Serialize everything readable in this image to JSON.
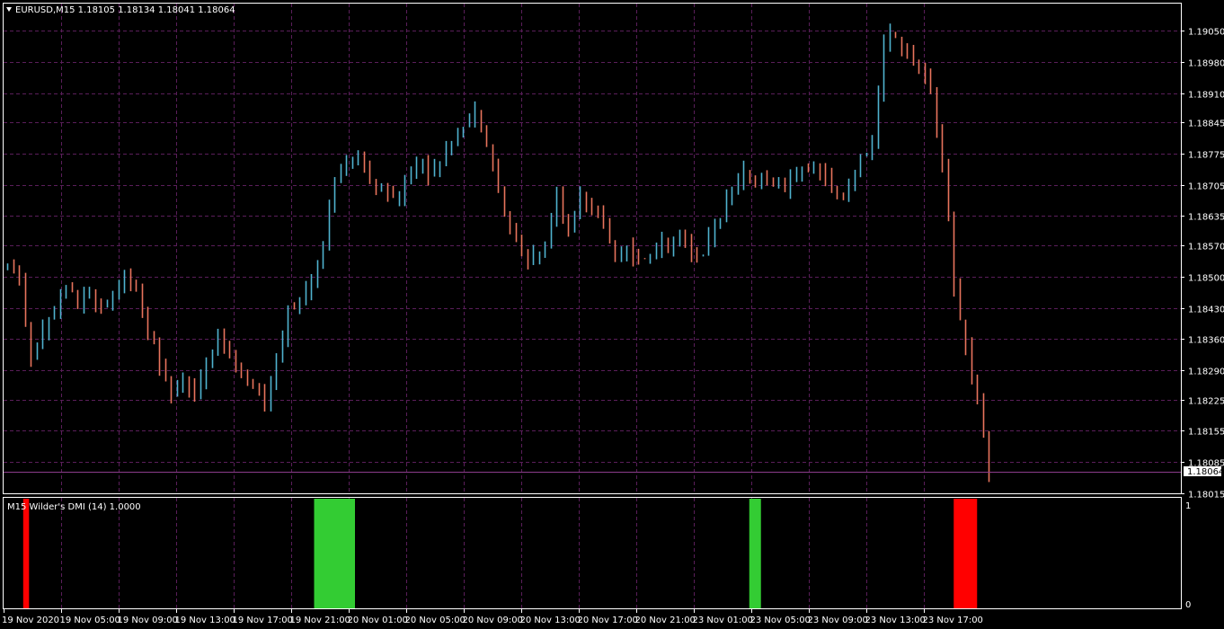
{
  "window": {
    "symbol_title": "EURUSD,M15  1.18105 1.18134 1.18041 1.18064",
    "menu_icon": "triangle-down-icon"
  },
  "indicator": {
    "title": "M15 Wilder's DMI (14) 1.0000",
    "scale_max": "1",
    "scale_min": "0"
  },
  "colors": {
    "background": "#000000",
    "grid": "#5a1e5a",
    "bull_candle": "#4fb3cf",
    "bear_candle": "#e8745c",
    "up_bar": "#33cc33",
    "down_bar": "#ff0000",
    "price_line": "#8c3c8c"
  },
  "chart_data": [
    {
      "type": "candlestick",
      "symbol": "EURUSD",
      "timeframe": "M15",
      "ylim": [
        1.18015,
        1.19075
      ],
      "grid": true,
      "y_ticks": [
        "1.19050",
        "1.18980",
        "1.18910",
        "1.18845",
        "1.18775",
        "1.18705",
        "1.18635",
        "1.18570",
        "1.18500",
        "1.18430",
        "1.18360",
        "1.18290",
        "1.18225",
        "1.18155",
        "1.18085",
        "1.18015"
      ],
      "x_ticks": [
        "19 Nov 2020",
        "19 Nov 05:00",
        "19 Nov 09:00",
        "19 Nov 13:00",
        "19 Nov 17:00",
        "19 Nov 21:00",
        "20 Nov 01:00",
        "20 Nov 05:00",
        "20 Nov 09:00",
        "20 Nov 13:00",
        "20 Nov 17:00",
        "20 Nov 21:00",
        "23 Nov 01:00",
        "23 Nov 05:00",
        "23 Nov 09:00",
        "23 Nov 13:00",
        "23 Nov 17:00"
      ],
      "current_price": "1.18064",
      "close_path": [
        [
          0,
          1.1852
        ],
        [
          2,
          1.185
        ],
        [
          4,
          1.1831
        ],
        [
          6,
          1.1838
        ],
        [
          8,
          1.1842
        ],
        [
          10,
          1.1849
        ],
        [
          12,
          1.1844
        ],
        [
          14,
          1.1846
        ],
        [
          16,
          1.1843
        ],
        [
          18,
          1.1846
        ],
        [
          20,
          1.185
        ],
        [
          22,
          1.1846
        ],
        [
          24,
          1.1837
        ],
        [
          26,
          1.1831
        ],
        [
          28,
          1.1823
        ],
        [
          30,
          1.1828
        ],
        [
          32,
          1.1823
        ],
        [
          34,
          1.183
        ],
        [
          36,
          1.1836
        ],
        [
          38,
          1.1832
        ],
        [
          40,
          1.1828
        ],
        [
          42,
          1.1825
        ],
        [
          44,
          1.1822
        ],
        [
          46,
          1.1832
        ],
        [
          48,
          1.1843
        ],
        [
          50,
          1.1845
        ],
        [
          52,
          1.185
        ],
        [
          54,
          1.1858
        ],
        [
          56,
          1.1872
        ],
        [
          58,
          1.1876
        ],
        [
          60,
          1.1878
        ],
        [
          62,
          1.1872
        ],
        [
          64,
          1.187
        ],
        [
          66,
          1.1867
        ],
        [
          68,
          1.1871
        ],
        [
          70,
          1.1876
        ],
        [
          72,
          1.1874
        ],
        [
          74,
          1.1876
        ],
        [
          76,
          1.188
        ],
        [
          78,
          1.1884
        ],
        [
          80,
          1.1887
        ],
        [
          82,
          1.1879
        ],
        [
          84,
          1.1868
        ],
        [
          86,
          1.1862
        ],
        [
          88,
          1.1856
        ],
        [
          90,
          1.1854
        ],
        [
          92,
          1.1857
        ],
        [
          94,
          1.1867
        ],
        [
          96,
          1.186
        ],
        [
          98,
          1.1867
        ],
        [
          100,
          1.1866
        ],
        [
          102,
          1.1862
        ],
        [
          104,
          1.1855
        ],
        [
          106,
          1.1856
        ],
        [
          108,
          1.1854
        ],
        [
          110,
          1.1855
        ],
        [
          112,
          1.1857
        ],
        [
          114,
          1.1857
        ],
        [
          116,
          1.1858
        ],
        [
          118,
          1.1854
        ],
        [
          120,
          1.1858
        ],
        [
          122,
          1.1864
        ],
        [
          124,
          1.187
        ],
        [
          126,
          1.1874
        ],
        [
          128,
          1.1871
        ],
        [
          130,
          1.1872
        ],
        [
          132,
          1.187
        ],
        [
          134,
          1.1871
        ],
        [
          136,
          1.1873
        ],
        [
          138,
          1.1874
        ],
        [
          140,
          1.1872
        ],
        [
          142,
          1.1868
        ],
        [
          144,
          1.187
        ],
        [
          146,
          1.1876
        ],
        [
          148,
          1.188
        ],
        [
          150,
          1.1903
        ],
        [
          152,
          1.1903
        ],
        [
          154,
          1.19
        ],
        [
          156,
          1.1897
        ],
        [
          158,
          1.1892
        ],
        [
          160,
          1.1875
        ],
        [
          162,
          1.1848
        ],
        [
          164,
          1.1835
        ],
        [
          166,
          1.1823
        ],
        [
          168,
          1.1806
        ]
      ]
    },
    {
      "type": "bar",
      "name": "Wilder's DMI (14)",
      "ylim": [
        0,
        1
      ],
      "signals": [
        {
          "from": 1.2,
          "to": 2.2,
          "value": 1,
          "color": "down"
        },
        {
          "from": 51.0,
          "to": 58.0,
          "value": 1,
          "color": "up"
        },
        {
          "from": 125.5,
          "to": 127.5,
          "value": 1,
          "color": "up"
        },
        {
          "from": 160.5,
          "to": 164.5,
          "value": 1,
          "color": "down"
        }
      ]
    }
  ]
}
